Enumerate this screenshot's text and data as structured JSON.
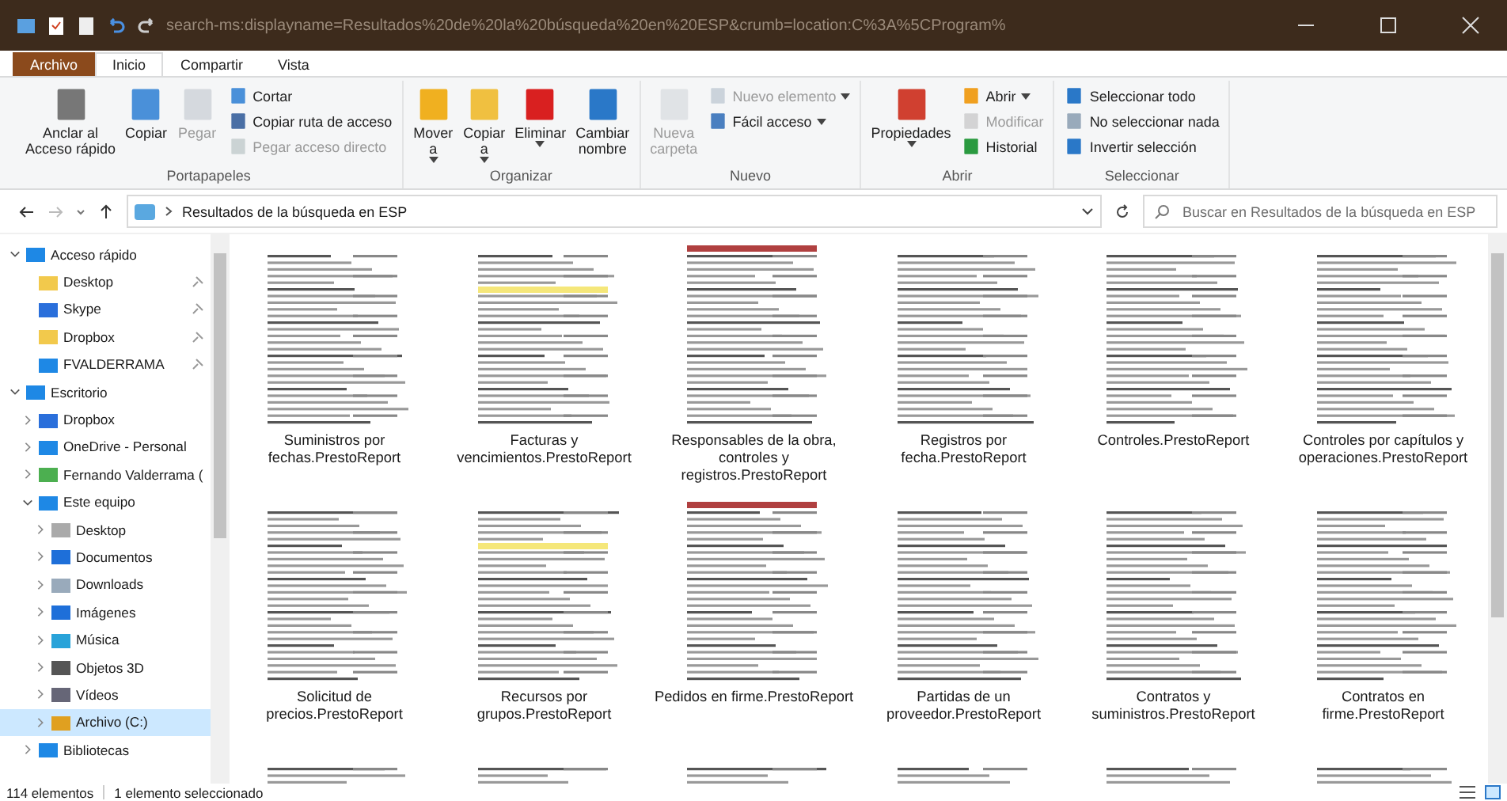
{
  "window": {
    "title": "search-ms:displayname=Resultados%20de%20la%20búsqueda%20en%20ESP&crumb=location:C%3A%5CProgram%"
  },
  "ribbon_tabs": [
    {
      "label": "Archivo",
      "kind": "file",
      "selected": false
    },
    {
      "label": "Inicio",
      "kind": "tab",
      "selected": true
    },
    {
      "label": "Compartir",
      "kind": "tab",
      "selected": false
    },
    {
      "label": "Vista",
      "kind": "tab",
      "selected": false
    }
  ],
  "ribbon_groups": [
    {
      "label": "Portapapeles",
      "buttons": [
        {
          "label": "Anclar al\nAcceso rápido",
          "kind": "large",
          "disabled": false,
          "dropdown": false
        },
        {
          "label": "Copiar",
          "kind": "large",
          "disabled": false,
          "dropdown": false
        },
        {
          "label": "Pegar",
          "kind": "large",
          "disabled": true,
          "dropdown": false
        },
        {
          "label": "Cortar",
          "kind": "small",
          "disabled": false,
          "dropdown": false
        },
        {
          "label": "Copiar ruta de acceso",
          "kind": "small",
          "disabled": false,
          "dropdown": false
        },
        {
          "label": "Pegar acceso directo",
          "kind": "small",
          "disabled": true,
          "dropdown": false
        }
      ]
    },
    {
      "label": "Organizar",
      "buttons": [
        {
          "label": "Mover\na",
          "kind": "large",
          "disabled": false,
          "dropdown": true
        },
        {
          "label": "Copiar\na",
          "kind": "large",
          "disabled": false,
          "dropdown": true
        },
        {
          "label": "Eliminar",
          "kind": "large",
          "disabled": false,
          "dropdown": true
        },
        {
          "label": "Cambiar\nnombre",
          "kind": "large",
          "disabled": false,
          "dropdown": false
        }
      ]
    },
    {
      "label": "Nuevo",
      "buttons": [
        {
          "label": "Nueva\ncarpeta",
          "kind": "large",
          "disabled": true,
          "dropdown": false
        },
        {
          "label": "Nuevo elemento",
          "kind": "small",
          "disabled": true,
          "dropdown": true
        },
        {
          "label": "Fácil acceso",
          "kind": "small",
          "disabled": false,
          "dropdown": true
        }
      ]
    },
    {
      "label": "Abrir",
      "buttons": [
        {
          "label": "Propiedades",
          "kind": "large",
          "disabled": false,
          "dropdown": true
        },
        {
          "label": "Abrir",
          "kind": "small",
          "disabled": false,
          "dropdown": true
        },
        {
          "label": "Modificar",
          "kind": "small",
          "disabled": true,
          "dropdown": false
        },
        {
          "label": "Historial",
          "kind": "small",
          "disabled": false,
          "dropdown": false
        }
      ]
    },
    {
      "label": "Seleccionar",
      "buttons": [
        {
          "label": "Seleccionar todo",
          "kind": "small",
          "disabled": false,
          "dropdown": false
        },
        {
          "label": "No seleccionar nada",
          "kind": "small",
          "disabled": false,
          "dropdown": false
        },
        {
          "label": "Invertir selección",
          "kind": "small",
          "disabled": false,
          "dropdown": false
        }
      ]
    }
  ],
  "address": {
    "path": "Resultados de la búsqueda en ESP"
  },
  "search": {
    "placeholder": "Buscar en Resultados de la búsqueda en ESP"
  },
  "sidebar": {
    "items": [
      {
        "label": "Acceso rápido",
        "expanded": true,
        "selected": false,
        "children": [
          {
            "label": "Desktop",
            "pinned": true,
            "selected": false
          },
          {
            "label": "Skype",
            "pinned": true,
            "selected": false
          },
          {
            "label": "Dropbox",
            "pinned": true,
            "selected": false
          },
          {
            "label": "FVALDERRAMA",
            "pinned": true,
            "selected": false
          }
        ]
      },
      {
        "label": "Escritorio",
        "expanded": true,
        "selected": false,
        "children": [
          {
            "label": "Dropbox",
            "expanded": false,
            "selected": false
          },
          {
            "label": "OneDrive - Personal",
            "expanded": false,
            "selected": false
          },
          {
            "label": "Fernando Valderrama (",
            "expanded": false,
            "selected": false
          },
          {
            "label": "Este equipo",
            "expanded": true,
            "selected": false,
            "children": [
              {
                "label": "Desktop",
                "expanded": false,
                "selected": false
              },
              {
                "label": "Documentos",
                "expanded": false,
                "selected": false
              },
              {
                "label": "Downloads",
                "expanded": false,
                "selected": false
              },
              {
                "label": "Imágenes",
                "expanded": false,
                "selected": false
              },
              {
                "label": "Música",
                "expanded": false,
                "selected": false
              },
              {
                "label": "Objetos 3D",
                "expanded": false,
                "selected": false
              },
              {
                "label": "Vídeos",
                "expanded": false,
                "selected": false
              },
              {
                "label": "Archivo (C:)",
                "expanded": false,
                "selected": true
              }
            ]
          },
          {
            "label": "Bibliotecas",
            "expanded": false,
            "selected": false
          }
        ]
      }
    ]
  },
  "files": [
    {
      "kind": "full",
      "name": "Suministros por\nfechas.PrestoReport"
    },
    {
      "kind": "full",
      "name": "Facturas y\nvencimientos.PrestoReport"
    },
    {
      "kind": "full",
      "name": "Responsables de la obra,\ncontroles y\nregistros.PrestoReport"
    },
    {
      "kind": "full",
      "name": "Registros por\nfecha.PrestoReport"
    },
    {
      "kind": "full",
      "name": "Controles.PrestoReport"
    },
    {
      "kind": "full",
      "name": "Controles por capítulos y\noperaciones.PrestoReport"
    },
    {
      "kind": "full",
      "name": "Solicitud de\nprecios.PrestoReport"
    },
    {
      "kind": "full",
      "name": "Recursos por\ngrupos.PrestoReport"
    },
    {
      "kind": "full",
      "name": "Pedidos en firme.PrestoReport"
    },
    {
      "kind": "full",
      "name": "Partidas de un\nproveedor.PrestoReport"
    },
    {
      "kind": "full",
      "name": "Contratos y\nsuministros.PrestoReport"
    },
    {
      "kind": "full",
      "name": "Contratos en\nfirme.PrestoReport"
    },
    {
      "kind": "cut"
    },
    {
      "kind": "cut"
    },
    {
      "kind": "cut"
    },
    {
      "kind": "cut"
    },
    {
      "kind": "cut"
    },
    {
      "kind": "cut"
    }
  ],
  "status_bar": {
    "count": "114 elementos",
    "selection": "1 elemento seleccionado"
  }
}
